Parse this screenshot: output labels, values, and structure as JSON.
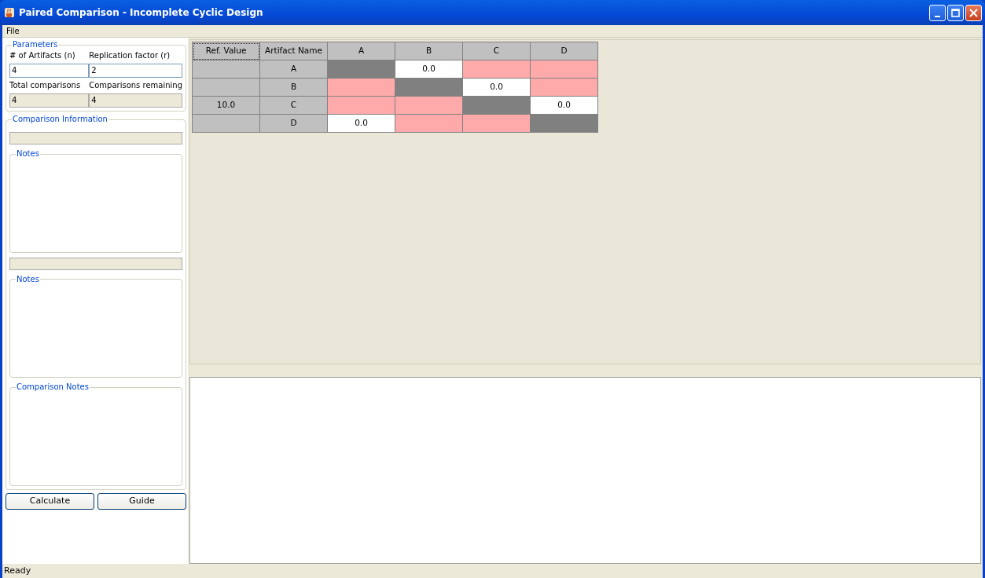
{
  "window": {
    "title": "Paired Comparison - Incomplete Cyclic Design"
  },
  "menu": [
    "File"
  ],
  "parameters": {
    "legend": "Parameters",
    "fields": [
      {
        "label": "# of Artifacts (n)",
        "value": "4",
        "disabled": false
      },
      {
        "label": "Replication factor (r)",
        "value": "2",
        "disabled": false
      },
      {
        "label": "Total comparisons",
        "value": "4",
        "disabled": true
      },
      {
        "label": "Comparisons remaining",
        "value": "4",
        "disabled": true
      }
    ]
  },
  "comparison_info": {
    "legend": "Comparison Information",
    "items": [
      {
        "kind": "field",
        "disabled": true
      },
      {
        "kind": "notes",
        "legend": "Notes"
      },
      {
        "kind": "field",
        "disabled": true
      },
      {
        "kind": "notes",
        "legend": "Notes"
      },
      {
        "kind": "notes",
        "legend": "Comparison Notes"
      }
    ]
  },
  "buttons": [
    "Calculate",
    "Guide"
  ],
  "table": {
    "columns": [
      "Ref. Value",
      "Artifact Name",
      "A",
      "B",
      "C",
      "D"
    ],
    "rows": [
      {
        "cells": [
          {
            "kind": "ref"
          },
          {
            "kind": "name",
            "text": "A"
          },
          {
            "kind": "diagonal"
          },
          {
            "kind": "value",
            "text": "0.0"
          },
          {
            "kind": "empty"
          },
          {
            "kind": "empty"
          }
        ]
      },
      {
        "cells": [
          {
            "kind": "ref"
          },
          {
            "kind": "name",
            "text": "B"
          },
          {
            "kind": "empty"
          },
          {
            "kind": "diagonal"
          },
          {
            "kind": "value",
            "text": "0.0"
          },
          {
            "kind": "empty"
          }
        ]
      },
      {
        "cells": [
          {
            "kind": "ref",
            "text": "10.0"
          },
          {
            "kind": "name",
            "text": "C"
          },
          {
            "kind": "empty"
          },
          {
            "kind": "empty"
          },
          {
            "kind": "diagonal"
          },
          {
            "kind": "value",
            "text": "0.0"
          }
        ]
      },
      {
        "cells": [
          {
            "kind": "ref"
          },
          {
            "kind": "name",
            "text": "D"
          },
          {
            "kind": "value",
            "text": "0.0"
          },
          {
            "kind": "empty"
          },
          {
            "kind": "empty"
          },
          {
            "kind": "diagonal"
          }
        ]
      }
    ]
  },
  "status_bar": "Ready"
}
